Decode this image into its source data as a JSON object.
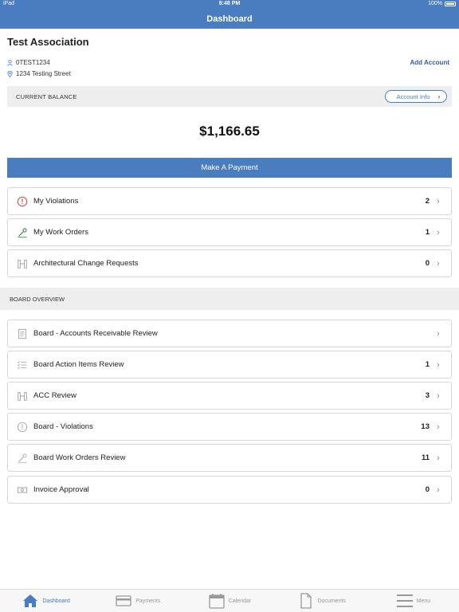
{
  "status_bar": {
    "carrier": "iPad",
    "time": "8:48 PM",
    "battery": "100%"
  },
  "nav": {
    "title": "Dashboard"
  },
  "account": {
    "name": "Test Association",
    "id": "0TEST1234",
    "address": "1234 Testing Street",
    "add_account_label": "Add Account"
  },
  "balance": {
    "label": "CURRENT BALANCE",
    "account_info_label": "Account Info",
    "amount": "$1,166.65",
    "pay_label": "Make A Payment"
  },
  "my_items": [
    {
      "label": "My Violations",
      "count": "2",
      "icon": "warning-icon"
    },
    {
      "label": "My Work Orders",
      "count": "1",
      "icon": "wrench-icon"
    },
    {
      "label": "Architectural Change Requests",
      "count": "0",
      "icon": "building-icon"
    }
  ],
  "board": {
    "header": "BOARD OVERVIEW",
    "items": [
      {
        "label": "Board - Accounts Receivable Review",
        "count": "",
        "icon": "document-icon"
      },
      {
        "label": "Board Action Items Review",
        "count": "1",
        "icon": "checklist-icon"
      },
      {
        "label": "ACC Review",
        "count": "3",
        "icon": "building-icon"
      },
      {
        "label": "Board - Violations",
        "count": "13",
        "icon": "warning-icon"
      },
      {
        "label": "Board Work Orders Review",
        "count": "11",
        "icon": "wrench-icon"
      },
      {
        "label": "Invoice Approval",
        "count": "0",
        "icon": "money-icon"
      }
    ]
  },
  "tabs": [
    {
      "label": "Dashboard",
      "icon": "home-icon",
      "active": true
    },
    {
      "label": "Payments",
      "icon": "card-icon",
      "active": false
    },
    {
      "label": "Calendar",
      "icon": "calendar-icon",
      "active": false
    },
    {
      "label": "Documents",
      "icon": "document-icon",
      "active": false
    },
    {
      "label": "Menu",
      "icon": "menu-icon",
      "active": false
    }
  ],
  "colors": {
    "primary": "#4a7cc0",
    "link": "#2c5fa8",
    "violation": "#d9534f",
    "workorder": "#3a8a3a"
  }
}
